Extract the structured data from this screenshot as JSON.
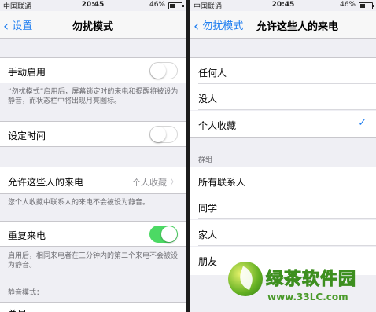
{
  "left": {
    "status": {
      "carrier": "中国联通",
      "time": "20:45",
      "battery": "46%"
    },
    "nav": {
      "back": "设置",
      "title": "勿扰模式"
    },
    "manual_enable": {
      "label": "手动启用",
      "on": false
    },
    "manual_note": "“勿扰模式”启用后，屏幕锁定时的来电和提醒将被设为静音，而状态栏中将出现月亮图标。",
    "scheduled": {
      "label": "设定时间",
      "on": false
    },
    "allow_calls": {
      "label": "允许这些人的来电",
      "value": "个人收藏"
    },
    "allow_note": "您个人收藏中联系人的来电不会被设为静音。",
    "repeated_calls": {
      "label": "重复来电",
      "on": true
    },
    "repeated_note": "启用后，相同来电者在三分钟内的第二个来电不会被设为静音。",
    "silence_header": "静音模式：",
    "partial_row": "总是"
  },
  "right": {
    "status": {
      "carrier": "中国联通",
      "time": "20:45",
      "battery": "46%"
    },
    "nav": {
      "back": "勿扰模式",
      "title": "允许这些人的来电"
    },
    "options": [
      "任何人",
      "没人",
      "个人收藏"
    ],
    "selected": "个人收藏",
    "groups_header": "群组",
    "groups": [
      "所有联系人",
      "同学",
      "家人",
      "朋友"
    ]
  },
  "watermark": {
    "text": "绿茶软件园",
    "url": "www.33LC.com"
  },
  "colors": {
    "accent": "#1f7ef0",
    "toggle_on": "#4cd964",
    "background": "#efeff4"
  }
}
